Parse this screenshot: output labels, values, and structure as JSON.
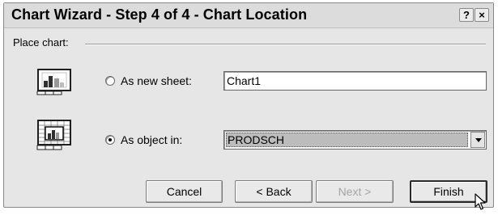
{
  "window": {
    "title": "Chart Wizard - Step 4 of 4 - Chart Location",
    "help_label": "?",
    "close_label": "×"
  },
  "group": {
    "label": "Place chart:"
  },
  "options": [
    {
      "label": "As new sheet:",
      "selected": false,
      "value": "Chart1",
      "icon": "chart-sheet-icon"
    },
    {
      "label": "As object in:",
      "selected": true,
      "value": "PRODSCH",
      "icon": "embedded-chart-icon"
    }
  ],
  "buttons": {
    "cancel": "Cancel",
    "back": "< Back",
    "next": "Next >",
    "finish": "Finish"
  },
  "cursor_icon": "mouse-pointer-icon"
}
